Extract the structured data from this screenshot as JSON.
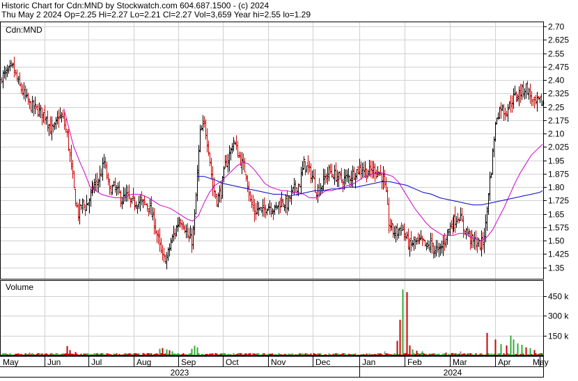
{
  "header": {
    "line1": "Historic Chart for Cdn:MND by Stockwatch.com 604.687.1500 - (c) 2024",
    "line2": "Thu May  2 2024  Op=2.25  Hi=2.27  Lo=2.21  Cl=2.27  Vol=3,659  Year hi=2.55  lo=1.29"
  },
  "chart_data": {
    "type": "ohlc",
    "symbol_label": "Cdn:MND",
    "volume_label": "Volume",
    "price_axis": {
      "range": [
        1.29,
        2.72
      ],
      "ticks": [
        "2.70",
        "2.625",
        "2.55",
        "2.475",
        "2.40",
        "2.325",
        "2.25",
        "2.175",
        "2.10",
        "2.025",
        "1.95",
        "1.875",
        "1.80",
        "1.725",
        "1.65",
        "1.575",
        "1.50",
        "1.425",
        "1.35"
      ]
    },
    "volume_axis": {
      "range": [
        0,
        560
      ],
      "ticks": [
        {
          "v": 450,
          "label": "450 k"
        },
        {
          "v": 300,
          "label": "300 k"
        },
        {
          "v": 150,
          "label": "150 k"
        }
      ]
    },
    "months": [
      "May",
      "Jun",
      "Jul",
      "Aug",
      "Sep",
      "Oct",
      "Nov",
      "Dec",
      "Jan",
      "Feb",
      "Mar",
      "Apr",
      "May"
    ],
    "years": [
      "2023",
      "2024"
    ],
    "grid": true,
    "colors": {
      "up_bar": "#000000",
      "down_bar": "#cc0000",
      "ma_short": "#cc00cc",
      "ma_long": "#0000cc",
      "vol_up": "#33aa33",
      "vol_down": "#cc0000",
      "vol_neutral": "#999999",
      "grid": "#d0d0d0"
    },
    "price_anchors": [
      [
        0,
        2.42
      ],
      [
        4,
        2.44
      ],
      [
        8,
        2.47
      ],
      [
        12,
        2.38
      ],
      [
        16,
        2.32
      ],
      [
        20,
        2.26
      ],
      [
        24,
        2.24
      ],
      [
        28,
        2.22
      ],
      [
        32,
        2.2
      ],
      [
        35,
        2.12
      ],
      [
        38,
        2.13
      ],
      [
        41,
        2.2
      ],
      [
        44,
        2.18
      ],
      [
        47,
        2.09
      ],
      [
        49,
        1.97
      ],
      [
        51,
        1.85
      ],
      [
        53,
        1.72
      ],
      [
        55,
        1.65
      ],
      [
        58,
        1.71
      ],
      [
        60,
        1.69
      ],
      [
        63,
        1.73
      ],
      [
        66,
        1.8
      ],
      [
        70,
        1.84
      ],
      [
        72,
        1.88
      ],
      [
        74,
        1.94
      ],
      [
        76,
        1.86
      ],
      [
        78,
        1.78
      ],
      [
        81,
        1.8
      ],
      [
        84,
        1.77
      ],
      [
        87,
        1.73
      ],
      [
        90,
        1.75
      ],
      [
        94,
        1.71
      ],
      [
        98,
        1.72
      ],
      [
        102,
        1.71
      ],
      [
        106,
        1.7
      ],
      [
        110,
        1.6
      ],
      [
        113,
        1.5
      ],
      [
        116,
        1.4
      ],
      [
        119,
        1.4
      ],
      [
        122,
        1.49
      ],
      [
        125,
        1.55
      ],
      [
        128,
        1.62
      ],
      [
        131,
        1.6
      ],
      [
        134,
        1.52
      ],
      [
        137,
        1.5
      ],
      [
        139,
        1.62
      ],
      [
        141,
        1.88
      ],
      [
        143,
        2.1
      ],
      [
        146,
        2.15
      ],
      [
        149,
        2.02
      ],
      [
        152,
        1.8
      ],
      [
        155,
        1.73
      ],
      [
        158,
        1.78
      ],
      [
        161,
        1.92
      ],
      [
        164,
        1.98
      ],
      [
        167,
        2.06
      ],
      [
        170,
        1.99
      ],
      [
        173,
        1.93
      ],
      [
        176,
        1.88
      ],
      [
        179,
        1.72
      ],
      [
        182,
        1.66
      ],
      [
        185,
        1.68
      ],
      [
        188,
        1.66
      ],
      [
        191,
        1.7
      ],
      [
        194,
        1.69
      ],
      [
        197,
        1.67
      ],
      [
        200,
        1.71
      ],
      [
        203,
        1.72
      ],
      [
        206,
        1.7
      ],
      [
        209,
        1.76
      ],
      [
        212,
        1.8
      ],
      [
        215,
        1.82
      ],
      [
        218,
        1.93
      ],
      [
        221,
        1.9
      ],
      [
        224,
        1.86
      ],
      [
        227,
        1.78
      ],
      [
        230,
        1.8
      ],
      [
        233,
        1.85
      ],
      [
        236,
        1.89
      ],
      [
        239,
        1.87
      ],
      [
        242,
        1.86
      ],
      [
        245,
        1.84
      ],
      [
        248,
        1.85
      ],
      [
        251,
        1.86
      ],
      [
        254,
        1.88
      ],
      [
        257,
        1.9
      ],
      [
        260,
        1.91
      ],
      [
        263,
        1.88
      ],
      [
        266,
        1.89
      ],
      [
        269,
        1.9
      ],
      [
        272,
        1.88
      ],
      [
        275,
        1.85
      ],
      [
        277,
        1.75
      ],
      [
        279,
        1.6
      ],
      [
        282,
        1.55
      ],
      [
        285,
        1.55
      ],
      [
        288,
        1.58
      ],
      [
        291,
        1.52
      ],
      [
        294,
        1.47
      ],
      [
        297,
        1.49
      ],
      [
        300,
        1.49
      ],
      [
        303,
        1.49
      ],
      [
        306,
        1.46
      ],
      [
        309,
        1.48
      ],
      [
        312,
        1.45
      ],
      [
        315,
        1.44
      ],
      [
        318,
        1.48
      ],
      [
        321,
        1.55
      ],
      [
        324,
        1.59
      ],
      [
        327,
        1.62
      ],
      [
        330,
        1.64
      ],
      [
        333,
        1.57
      ],
      [
        336,
        1.55
      ],
      [
        339,
        1.5
      ],
      [
        342,
        1.49
      ],
      [
        345,
        1.47
      ],
      [
        347,
        1.5
      ],
      [
        349,
        1.58
      ],
      [
        351,
        1.78
      ],
      [
        353,
        1.9
      ],
      [
        355,
        2.08
      ],
      [
        357,
        2.2
      ],
      [
        360,
        2.25
      ],
      [
        363,
        2.22
      ],
      [
        366,
        2.26
      ],
      [
        369,
        2.3
      ],
      [
        372,
        2.32
      ],
      [
        375,
        2.34
      ],
      [
        378,
        2.36
      ],
      [
        381,
        2.31
      ],
      [
        384,
        2.26
      ],
      [
        387,
        2.28
      ],
      [
        390,
        2.27
      ]
    ],
    "ma_short": [
      [
        45,
        2.24
      ],
      [
        48,
        2.15
      ],
      [
        52,
        2.03
      ],
      [
        56,
        1.95
      ],
      [
        60,
        1.88
      ],
      [
        64,
        1.8
      ],
      [
        68,
        1.78
      ],
      [
        72,
        1.76
      ],
      [
        76,
        1.75
      ],
      [
        82,
        1.74
      ],
      [
        88,
        1.74
      ],
      [
        94,
        1.76
      ],
      [
        100,
        1.76
      ],
      [
        106,
        1.74
      ],
      [
        110,
        1.72
      ],
      [
        114,
        1.7
      ],
      [
        118,
        1.69
      ],
      [
        122,
        1.68
      ],
      [
        126,
        1.66
      ],
      [
        130,
        1.64
      ],
      [
        134,
        1.62
      ],
      [
        138,
        1.61
      ],
      [
        142,
        1.64
      ],
      [
        146,
        1.71
      ],
      [
        150,
        1.77
      ],
      [
        154,
        1.81
      ],
      [
        158,
        1.83
      ],
      [
        162,
        1.86
      ],
      [
        166,
        1.89
      ],
      [
        170,
        1.92
      ],
      [
        174,
        1.94
      ],
      [
        178,
        1.93
      ],
      [
        182,
        1.9
      ],
      [
        186,
        1.86
      ],
      [
        190,
        1.82
      ],
      [
        194,
        1.8
      ],
      [
        198,
        1.79
      ],
      [
        202,
        1.78
      ],
      [
        206,
        1.78
      ],
      [
        210,
        1.77
      ],
      [
        214,
        1.77
      ],
      [
        218,
        1.76
      ],
      [
        222,
        1.74
      ],
      [
        226,
        1.74
      ],
      [
        230,
        1.76
      ],
      [
        234,
        1.78
      ],
      [
        238,
        1.78
      ],
      [
        242,
        1.79
      ],
      [
        246,
        1.8
      ],
      [
        250,
        1.81
      ],
      [
        254,
        1.82
      ],
      [
        258,
        1.84
      ],
      [
        262,
        1.86
      ],
      [
        266,
        1.87
      ],
      [
        270,
        1.88
      ],
      [
        274,
        1.88
      ],
      [
        278,
        1.87
      ],
      [
        282,
        1.86
      ],
      [
        286,
        1.83
      ],
      [
        290,
        1.78
      ],
      [
        294,
        1.73
      ],
      [
        298,
        1.68
      ],
      [
        302,
        1.64
      ],
      [
        306,
        1.6
      ],
      [
        310,
        1.57
      ],
      [
        314,
        1.55
      ],
      [
        318,
        1.53
      ],
      [
        322,
        1.53
      ],
      [
        326,
        1.53
      ],
      [
        330,
        1.54
      ],
      [
        334,
        1.54
      ],
      [
        338,
        1.52
      ],
      [
        342,
        1.51
      ],
      [
        346,
        1.5
      ],
      [
        350,
        1.52
      ],
      [
        354,
        1.56
      ],
      [
        358,
        1.62
      ],
      [
        362,
        1.68
      ],
      [
        366,
        1.75
      ],
      [
        370,
        1.82
      ],
      [
        374,
        1.88
      ],
      [
        378,
        1.93
      ],
      [
        382,
        1.98
      ],
      [
        386,
        2.01
      ],
      [
        390,
        2.04
      ]
    ],
    "ma_long": [
      [
        141,
        1.86
      ],
      [
        146,
        1.86
      ],
      [
        150,
        1.85
      ],
      [
        154,
        1.84
      ],
      [
        160,
        1.82
      ],
      [
        166,
        1.81
      ],
      [
        172,
        1.8
      ],
      [
        178,
        1.79
      ],
      [
        184,
        1.78
      ],
      [
        190,
        1.77
      ],
      [
        196,
        1.76
      ],
      [
        202,
        1.76
      ],
      [
        208,
        1.75
      ],
      [
        214,
        1.76
      ],
      [
        220,
        1.77
      ],
      [
        226,
        1.78
      ],
      [
        232,
        1.78
      ],
      [
        238,
        1.79
      ],
      [
        244,
        1.79
      ],
      [
        250,
        1.8
      ],
      [
        256,
        1.8
      ],
      [
        262,
        1.81
      ],
      [
        268,
        1.82
      ],
      [
        274,
        1.83
      ],
      [
        280,
        1.83
      ],
      [
        286,
        1.82
      ],
      [
        292,
        1.81
      ],
      [
        298,
        1.79
      ],
      [
        304,
        1.77
      ],
      [
        310,
        1.76
      ],
      [
        316,
        1.74
      ],
      [
        322,
        1.73
      ],
      [
        328,
        1.72
      ],
      [
        334,
        1.71
      ],
      [
        340,
        1.7
      ],
      [
        346,
        1.7
      ],
      [
        352,
        1.71
      ],
      [
        358,
        1.72
      ],
      [
        364,
        1.73
      ],
      [
        370,
        1.74
      ],
      [
        376,
        1.75
      ],
      [
        382,
        1.76
      ],
      [
        388,
        1.77
      ],
      [
        390,
        1.78
      ]
    ],
    "volume_spikes": [
      [
        47,
        70,
        "down"
      ],
      [
        49,
        40,
        "down"
      ],
      [
        53,
        25,
        "down"
      ],
      [
        20,
        20,
        "up"
      ],
      [
        114,
        50,
        "up"
      ],
      [
        116,
        55,
        "down"
      ],
      [
        119,
        45,
        "up"
      ],
      [
        121,
        38,
        "down"
      ],
      [
        123,
        30,
        "up"
      ],
      [
        137,
        50,
        "up"
      ],
      [
        139,
        72,
        "up"
      ],
      [
        141,
        60,
        "up"
      ],
      [
        276,
        30,
        "neutral"
      ],
      [
        285,
        110,
        "down"
      ],
      [
        287,
        270,
        "down"
      ],
      [
        289,
        500,
        "up"
      ],
      [
        292,
        480,
        "down"
      ],
      [
        294,
        75,
        "down"
      ],
      [
        296,
        45,
        "up"
      ],
      [
        299,
        35,
        "down"
      ],
      [
        303,
        30,
        "up"
      ],
      [
        320,
        20,
        "down"
      ],
      [
        331,
        30,
        "neutral"
      ],
      [
        350,
        170,
        "down"
      ],
      [
        356,
        120,
        "down"
      ],
      [
        360,
        85,
        "up"
      ],
      [
        364,
        75,
        "down"
      ],
      [
        367,
        150,
        "up"
      ],
      [
        369,
        120,
        "up"
      ],
      [
        372,
        90,
        "up"
      ],
      [
        375,
        80,
        "up"
      ],
      [
        378,
        60,
        "down"
      ],
      [
        381,
        55,
        "up"
      ],
      [
        384,
        40,
        "down"
      ]
    ]
  }
}
